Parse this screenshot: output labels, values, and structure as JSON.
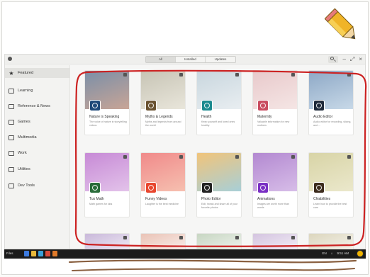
{
  "window": {
    "tabs": [
      {
        "label": "All",
        "active": true
      },
      {
        "label": "Installed",
        "active": false
      },
      {
        "label": "Updates",
        "active": false
      }
    ],
    "controls": {
      "search_icon": "search-icon",
      "minimize": "–",
      "maximize": "⤢",
      "close": "×"
    }
  },
  "sidebar": {
    "items": [
      {
        "label": "Featured",
        "icon": "star-icon",
        "active": true
      },
      {
        "label": "Learning",
        "icon": "learning-icon",
        "active": false
      },
      {
        "label": "Reference & News",
        "icon": "reference-icon",
        "active": false
      },
      {
        "label": "Games",
        "icon": "games-icon",
        "active": false
      },
      {
        "label": "Multimedia",
        "icon": "multimedia-icon",
        "active": false
      },
      {
        "label": "Work",
        "icon": "work-icon",
        "active": false
      },
      {
        "label": "Utilities",
        "icon": "utilities-icon",
        "active": false
      },
      {
        "label": "Dev Tools",
        "icon": "devtools-icon",
        "active": false
      }
    ]
  },
  "apps": {
    "row1": [
      {
        "name": "Nature is Speaking",
        "desc": "The voice of nature in storytelling videos",
        "art": "#7a8fa8",
        "art2": "#c9a596",
        "icon": "#1f4a7a"
      },
      {
        "name": "Myths & Legends",
        "desc": "Myths and legends from around the world",
        "art": "#c7c4b5",
        "art2": "#e9e6db",
        "icon": "#6a5230"
      },
      {
        "name": "Health",
        "desc": "Keep yourself and loved ones healthy",
        "art": "#c8d6de",
        "art2": "#e9eef1",
        "icon": "#1b8a8f"
      },
      {
        "name": "Maternity",
        "desc": "Valuable information for new mothers",
        "art": "#e8c9cb",
        "art2": "#f5e6e5",
        "icon": "#c94c60"
      },
      {
        "name": "Audio Editor",
        "desc": "Audio editor for recording, slicing, and ...",
        "art": "#8da8c6",
        "art2": "#c8d9e8",
        "icon": "#1f2a3a"
      }
    ],
    "row2": [
      {
        "name": "Tux Math",
        "desc": "Math games for kids",
        "art": "#c78ad6",
        "art2": "#e3c3ea",
        "icon": "#2a6c3a"
      },
      {
        "name": "Funny Videos",
        "desc": "Laughter is the best medicine",
        "art": "#f08a8a",
        "art2": "#f6c0b0",
        "icon": "#e8472f"
      },
      {
        "name": "Photo Editor",
        "desc": "Edit, tweak and share all of your favorite photos",
        "art": "#f1c47a",
        "art2": "#a7cfd8",
        "icon": "#222222"
      },
      {
        "name": "Animations",
        "desc": "Images are worth more than words",
        "art": "#b389d1",
        "art2": "#d7bde8",
        "icon": "#7a2fc4"
      },
      {
        "name": "Chiabilities",
        "desc": "Learn how to provide the best care",
        "art": "#d8d4a6",
        "art2": "#ebe8cc",
        "icon": "#3d2c1d"
      }
    ],
    "row3": [
      {
        "art": "#c9b8da"
      },
      {
        "art": "#eac3b6"
      },
      {
        "art": "#c7d6c2"
      },
      {
        "art": "#d4c4e0"
      },
      {
        "art": "#dcd6bd"
      }
    ]
  },
  "taskbar": {
    "activities": "Files",
    "dock_colors": [
      "#3d7be0",
      "#e8b83a",
      "#3aa0d8",
      "#d84a3a",
      "#e07a2a"
    ],
    "tray": [
      "EN",
      "⌂",
      "9:51 AM"
    ]
  },
  "colors": {
    "outline": "#cc2222",
    "scribble": "#8a6040",
    "pencil_body": "#f0b428",
    "pencil_tip": "#444444"
  }
}
